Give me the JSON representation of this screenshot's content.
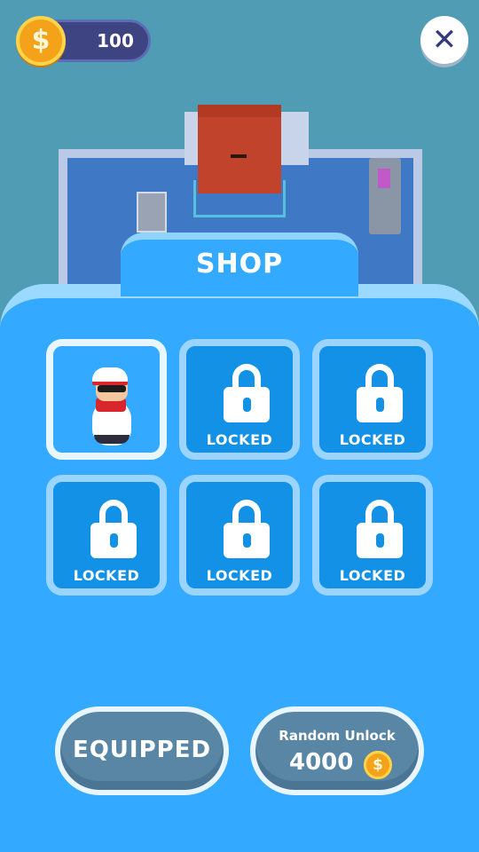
{
  "hud": {
    "coins": "100",
    "coin_symbol": "$",
    "close_symbol": "✕"
  },
  "shop": {
    "title": "SHOP",
    "slots": [
      {
        "state": "unlocked",
        "selected": true,
        "label": ""
      },
      {
        "state": "locked",
        "label": "LOCKED"
      },
      {
        "state": "locked",
        "label": "LOCKED"
      },
      {
        "state": "locked",
        "label": "LOCKED"
      },
      {
        "state": "locked",
        "label": "LOCKED"
      },
      {
        "state": "locked",
        "label": "LOCKED"
      }
    ]
  },
  "buttons": {
    "equipped_label": "EQUIPPED",
    "random_unlock_label": "Random Unlock",
    "random_unlock_price": "4000",
    "coin_symbol": "$"
  },
  "colors": {
    "panel": "#33aaff",
    "slot": "#1391e6",
    "coin": "#f5a21b",
    "button": "#5a86a6"
  }
}
